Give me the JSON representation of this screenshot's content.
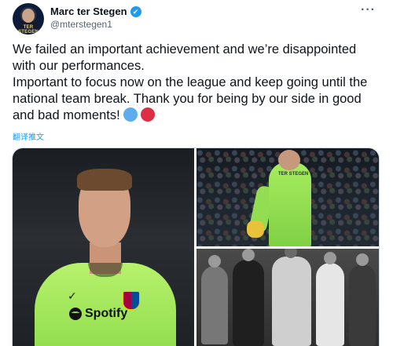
{
  "author": {
    "display_name": "Marc ter Stegen",
    "handle": "@mterstegen1",
    "avatar_text": "TER STEGEN",
    "verified_icon": "✔"
  },
  "menu": {
    "more_label": "···"
  },
  "tweet": {
    "paragraph_1": "We failed an important achievement and we’re disappointed with our performances.",
    "paragraph_2": "Important to focus now on the league and keep going until the national team break. Thank you for being by our side in good and bad moments!",
    "emojis": [
      "blue-circle",
      "red-circle"
    ],
    "translate_label": "翻译推文"
  },
  "media": {
    "photo_1": {
      "sponsor": "Spotify",
      "maker_mark": "✓"
    },
    "photo_2": {
      "shirt_text": "TER STEGEN"
    },
    "photo_3": {}
  },
  "colors": {
    "link": "#1d9bf0",
    "verified": "#1d9bf0",
    "kit_green": "#8fdb4c",
    "secondary_text": "#536471"
  }
}
